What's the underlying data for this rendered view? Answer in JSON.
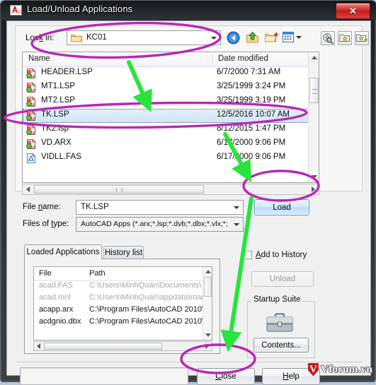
{
  "window": {
    "title": "Load/Unload Applications",
    "app_icon": "autocad-a10-icon",
    "close_glyph": "✕"
  },
  "browser": {
    "lookin_label": "Look in:",
    "lookin_value": "KC01",
    "toolbar_icons": [
      "back-navigate-icon",
      "up-one-level-icon",
      "create-new-folder-icon",
      "views-menu-icon"
    ],
    "right_icons": [
      "search-web-icon",
      "add-to-favorites-icon",
      "add-current-folder-icon"
    ],
    "columns": [
      "Name",
      "Date modified"
    ],
    "files": [
      {
        "name": "HEADER.LSP",
        "date": "6/7/2000 7:31 AM",
        "icon": "lsp-file-icon",
        "selected": false
      },
      {
        "name": "MT1.LSP",
        "date": "3/25/1999 3:24 PM",
        "icon": "lsp-file-icon",
        "selected": false
      },
      {
        "name": "MT2.LSP",
        "date": "3/25/1999 3:19 PM",
        "icon": "lsp-file-icon",
        "selected": false
      },
      {
        "name": "TK.LSP",
        "date": "12/5/2016 10:07 AM",
        "icon": "lsp-file-icon",
        "selected": true
      },
      {
        "name": "TK2.lsp",
        "date": "8/12/2015 1:47 PM",
        "icon": "lsp-file-icon",
        "selected": false
      },
      {
        "name": "VD.ARX",
        "date": "6/17/2000 9:06 PM",
        "icon": "arx-file-icon",
        "selected": false
      },
      {
        "name": "VIDLL.FAS",
        "date": "6/17/2000 9:06 PM",
        "icon": "fas-file-icon",
        "selected": false
      }
    ]
  },
  "fields": {
    "filename_label": "File name:",
    "filename_value": "TK.LSP",
    "filetype_label": "Files of type:",
    "filetype_value": "AutoCAD Apps (*.arx;*.lsp;*.dvb;*.dbx;*.vlx;*;"
  },
  "buttons": {
    "load": "Load",
    "unload": "Unload",
    "contents": "Contents...",
    "close": "Close",
    "help": "Help"
  },
  "tabs": [
    {
      "label": "Loaded Applications",
      "active": true
    },
    {
      "label": "History list",
      "active": false
    }
  ],
  "apps_table": {
    "columns": [
      "File",
      "Path"
    ],
    "rows": [
      {
        "file": "acad.FAS",
        "path": "C:\\Users\\MinhQuan\\Documents\\",
        "dim": true
      },
      {
        "file": "acad.mnl",
        "path": "C:\\Users\\MinhQuan\\appdata\\roami.",
        "dim": true
      },
      {
        "file": "acapp.arx",
        "path": "C:\\Program Files\\AutoCAD 2010\\",
        "dim": false
      },
      {
        "file": "acdgnio.dbx",
        "path": "C:\\Program Files\\AutoCAD 2010\\",
        "dim": false
      }
    ]
  },
  "right_panel": {
    "add_to_history_label": "Add to History",
    "add_to_history_checked": false,
    "startup_suite_title": "Startup Suite",
    "briefcase_icon": "briefcase-icon"
  },
  "status": {
    "text": ""
  },
  "watermark": {
    "mark": "V",
    "text": "Vforum.vn"
  },
  "annotations": {
    "highlight_color": "#b828b8",
    "arrow_color": "#28e43c",
    "ellipses": [
      "lookin-field-ellipse",
      "tk-lsp-row-ellipse",
      "load-button-ellipse",
      "close-button-ellipse"
    ],
    "arrows": [
      "arrow-to-file-list",
      "arrow-to-load-button",
      "arrow-to-close-button"
    ]
  }
}
